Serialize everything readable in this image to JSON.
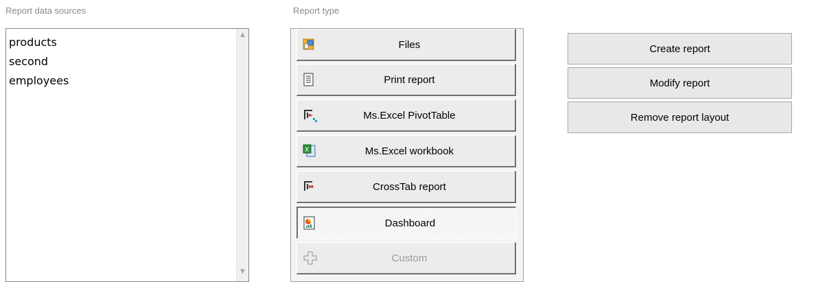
{
  "labels": {
    "data_sources": "Report data sources",
    "report_type": "Report type"
  },
  "data_sources": [
    "products",
    "second",
    "employees"
  ],
  "report_types": [
    {
      "label": "Files",
      "icon": "files-icon"
    },
    {
      "label": "Print report",
      "icon": "print-report-icon"
    },
    {
      "label": "Ms.Excel PivotTable",
      "icon": "pivottable-icon"
    },
    {
      "label": "Ms.Excel workbook",
      "icon": "excel-workbook-icon"
    },
    {
      "label": "CrossTab report",
      "icon": "crosstab-icon"
    },
    {
      "label": "Dashboard",
      "icon": "dashboard-icon",
      "selected": true
    },
    {
      "label": "Custom",
      "icon": "custom-plus-icon",
      "disabled": true
    }
  ],
  "actions": {
    "create": "Create report",
    "modify": "Modify report",
    "remove": "Remove report layout"
  }
}
